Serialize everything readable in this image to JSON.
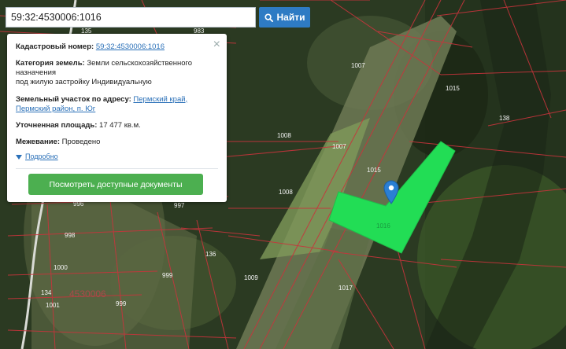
{
  "search": {
    "value": "59:32:4530006:1016",
    "button_label": "Найти"
  },
  "info": {
    "cadastral_label": "Кадастровый номер:",
    "cadastral_number": "59:32:4530006:1016",
    "category_label": "Категория земель:",
    "category_value_1": "Земли сельскохозяйственного",
    "category_value_2": "назначения",
    "category_value_3": "под жилую застройку Индивидуальную",
    "address_label": "Земельный участок по адресу:",
    "address_value_1": "Пермский край,",
    "address_value_2": "Пермский район, п. Юг",
    "area_label": "Уточненная площадь:",
    "area_value": "17 477 кв.м.",
    "survey_label": "Межевание:",
    "survey_value": "Проведено",
    "more_label": "Подробно",
    "docs_button": "Посмотреть доступные документы",
    "close_symbol": "×"
  },
  "map_labels": {
    "l1007a": "1007",
    "l1015a": "1015",
    "l138": "138",
    "l1008a": "1008",
    "l1007b": "1007",
    "l1015b": "1015",
    "l1008b": "1008",
    "l996": "996",
    "l997": "997",
    "l998": "998",
    "l1000": "1000",
    "l136": "136",
    "l999a": "999",
    "l1009": "1009",
    "l134": "134",
    "l1001": "1001",
    "lquarter": "4530006",
    "l999b": "999",
    "l1017": "1017",
    "l1016": "1016",
    "l135": "135",
    "l983": "983"
  },
  "colors": {
    "accent": "#2e7bc4",
    "parcel": "#22dd55",
    "button": "#4caf50",
    "marker": "#2a7fd4",
    "boundary": "#c8343c"
  },
  "icons": {
    "search": "magnifier-icon",
    "marker": "map-pin-icon",
    "close": "close-icon"
  }
}
